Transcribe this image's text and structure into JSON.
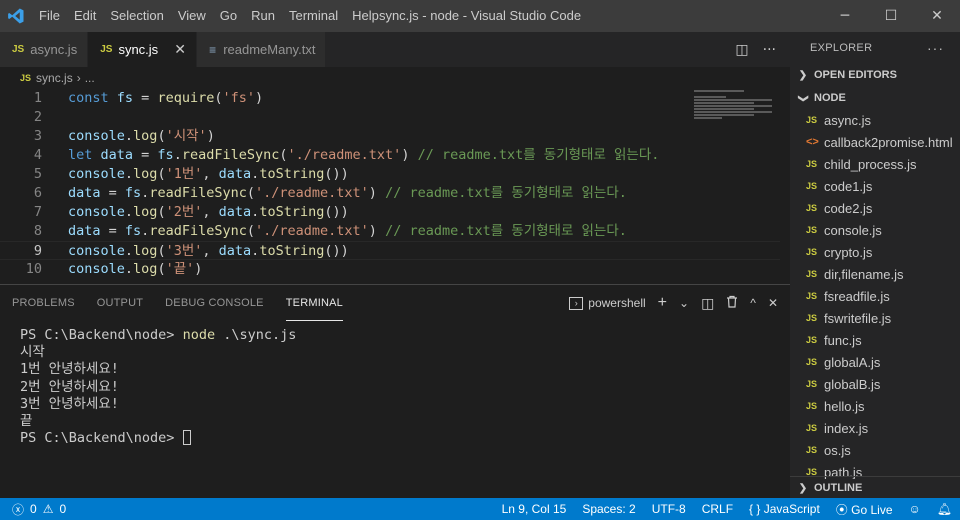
{
  "titlebar": {
    "menu": [
      "File",
      "Edit",
      "Selection",
      "View",
      "Go",
      "Run",
      "Terminal",
      "Help"
    ],
    "title": "sync.js - node - Visual Studio Code",
    "controls": {
      "minimize": "─",
      "maximize": "☐",
      "close": "✕"
    }
  },
  "tabs": [
    {
      "label": "async.js",
      "icon": "JS"
    },
    {
      "label": "sync.js",
      "icon": "JS",
      "close": "✕"
    },
    {
      "label": "readmeMany.txt",
      "icon": "≡"
    }
  ],
  "tab_actions": {
    "split": "◫",
    "more": "···"
  },
  "breadcrumb": {
    "icon": "JS",
    "file": "sync.js",
    "sep": "›",
    "rest": "..."
  },
  "code_lines": [
    {
      "n": "1",
      "parts": [
        {
          "c": "kw",
          "t": "const "
        },
        {
          "c": "var",
          "t": "fs"
        },
        {
          "c": "pl",
          "t": " = "
        },
        {
          "c": "fn",
          "t": "require"
        },
        {
          "c": "pl",
          "t": "("
        },
        {
          "c": "str",
          "t": "'fs'"
        },
        {
          "c": "pl",
          "t": ")"
        }
      ]
    },
    {
      "n": "2",
      "parts": []
    },
    {
      "n": "3",
      "parts": [
        {
          "c": "var",
          "t": "console"
        },
        {
          "c": "pl",
          "t": "."
        },
        {
          "c": "fn",
          "t": "log"
        },
        {
          "c": "pl",
          "t": "("
        },
        {
          "c": "str",
          "t": "'시작'"
        },
        {
          "c": "pl",
          "t": ")"
        }
      ]
    },
    {
      "n": "4",
      "parts": [
        {
          "c": "kw",
          "t": "let "
        },
        {
          "c": "var",
          "t": "data"
        },
        {
          "c": "pl",
          "t": " = "
        },
        {
          "c": "var",
          "t": "fs"
        },
        {
          "c": "pl",
          "t": "."
        },
        {
          "c": "fn",
          "t": "readFileSync"
        },
        {
          "c": "pl",
          "t": "("
        },
        {
          "c": "str",
          "t": "'./readme.txt'"
        },
        {
          "c": "pl",
          "t": ") "
        },
        {
          "c": "cm",
          "t": "// readme.txt를 동기형태로 읽는다."
        }
      ]
    },
    {
      "n": "5",
      "parts": [
        {
          "c": "var",
          "t": "console"
        },
        {
          "c": "pl",
          "t": "."
        },
        {
          "c": "fn",
          "t": "log"
        },
        {
          "c": "pl",
          "t": "("
        },
        {
          "c": "str",
          "t": "'1번'"
        },
        {
          "c": "pl",
          "t": ", "
        },
        {
          "c": "var",
          "t": "data"
        },
        {
          "c": "pl",
          "t": "."
        },
        {
          "c": "fn",
          "t": "toString"
        },
        {
          "c": "pl",
          "t": "())"
        }
      ]
    },
    {
      "n": "6",
      "parts": [
        {
          "c": "var",
          "t": "data"
        },
        {
          "c": "pl",
          "t": " = "
        },
        {
          "c": "var",
          "t": "fs"
        },
        {
          "c": "pl",
          "t": "."
        },
        {
          "c": "fn",
          "t": "readFileSync"
        },
        {
          "c": "pl",
          "t": "("
        },
        {
          "c": "str",
          "t": "'./readme.txt'"
        },
        {
          "c": "pl",
          "t": ") "
        },
        {
          "c": "cm",
          "t": "// readme.txt를 동기형태로 읽는다."
        }
      ]
    },
    {
      "n": "7",
      "parts": [
        {
          "c": "var",
          "t": "console"
        },
        {
          "c": "pl",
          "t": "."
        },
        {
          "c": "fn",
          "t": "log"
        },
        {
          "c": "pl",
          "t": "("
        },
        {
          "c": "str",
          "t": "'2번'"
        },
        {
          "c": "pl",
          "t": ", "
        },
        {
          "c": "var",
          "t": "data"
        },
        {
          "c": "pl",
          "t": "."
        },
        {
          "c": "fn",
          "t": "toString"
        },
        {
          "c": "pl",
          "t": "())"
        }
      ]
    },
    {
      "n": "8",
      "parts": [
        {
          "c": "var",
          "t": "data"
        },
        {
          "c": "pl",
          "t": " = "
        },
        {
          "c": "var",
          "t": "fs"
        },
        {
          "c": "pl",
          "t": "."
        },
        {
          "c": "fn",
          "t": "readFileSync"
        },
        {
          "c": "pl",
          "t": "("
        },
        {
          "c": "str",
          "t": "'./readme.txt'"
        },
        {
          "c": "pl",
          "t": ") "
        },
        {
          "c": "cm",
          "t": "// readme.txt를 동기형태로 읽는다."
        }
      ]
    },
    {
      "n": "9",
      "parts": [
        {
          "c": "var",
          "t": "console"
        },
        {
          "c": "pl",
          "t": "."
        },
        {
          "c": "fn",
          "t": "log"
        },
        {
          "c": "pl",
          "t": "("
        },
        {
          "c": "str",
          "t": "'3번'"
        },
        {
          "c": "pl",
          "t": ", "
        },
        {
          "c": "var",
          "t": "data"
        },
        {
          "c": "pl",
          "t": "."
        },
        {
          "c": "fn",
          "t": "toString"
        },
        {
          "c": "pl",
          "t": "())"
        }
      ]
    },
    {
      "n": "10",
      "parts": [
        {
          "c": "var",
          "t": "console"
        },
        {
          "c": "pl",
          "t": "."
        },
        {
          "c": "fn",
          "t": "log"
        },
        {
          "c": "pl",
          "t": "("
        },
        {
          "c": "str",
          "t": "'끝'"
        },
        {
          "c": "pl",
          "t": ")"
        }
      ]
    }
  ],
  "current_line": "9",
  "panel": {
    "tabs": [
      "PROBLEMS",
      "OUTPUT",
      "DEBUG CONSOLE",
      "TERMINAL"
    ],
    "active_tab": "TERMINAL",
    "shell": "powershell",
    "actions": {
      "add": "+",
      "dropdown": "⌄",
      "split": "◫",
      "trash": "🗑",
      "maximize": "^",
      "close": "✕"
    }
  },
  "terminal": {
    "prompt": "PS C:\\Backend\\node> ",
    "command": "node",
    "args": " .\\sync.js",
    "output": [
      "시작",
      "1번 안녕하세요!",
      "2번 안녕하세요!",
      "3번 안녕하세요!",
      "끝"
    ],
    "final_prompt": "PS C:\\Backend\\node> "
  },
  "sidebar": {
    "title": "EXPLORER",
    "more": "···",
    "open_editors": "OPEN EDITORS",
    "folder": "NODE",
    "outline": "OUTLINE",
    "files": [
      {
        "name": "async.js",
        "type": "js"
      },
      {
        "name": "callback2promise.html",
        "type": "html"
      },
      {
        "name": "child_process.js",
        "type": "js"
      },
      {
        "name": "code1.js",
        "type": "js"
      },
      {
        "name": "code2.js",
        "type": "js"
      },
      {
        "name": "console.js",
        "type": "js"
      },
      {
        "name": "crypto.js",
        "type": "js"
      },
      {
        "name": "dir,filename.js",
        "type": "js"
      },
      {
        "name": "fsreadfile.js",
        "type": "js"
      },
      {
        "name": "fswritefile.js",
        "type": "js"
      },
      {
        "name": "func.js",
        "type": "js"
      },
      {
        "name": "globalA.js",
        "type": "js"
      },
      {
        "name": "globalB.js",
        "type": "js"
      },
      {
        "name": "hello.js",
        "type": "js"
      },
      {
        "name": "index.js",
        "type": "js"
      },
      {
        "name": "os.js",
        "type": "js"
      },
      {
        "name": "path.js",
        "type": "js"
      }
    ]
  },
  "statusbar": {
    "errors": "0",
    "warnings": "0",
    "position": "Ln 9, Col 15",
    "spaces": "Spaces: 2",
    "encoding": "UTF-8",
    "eol": "CRLF",
    "language": "JavaScript",
    "golive": "Go Live"
  },
  "colors": {
    "accent": "#007acc",
    "js_badge": "#cbcb41",
    "html_badge": "#e37933"
  }
}
